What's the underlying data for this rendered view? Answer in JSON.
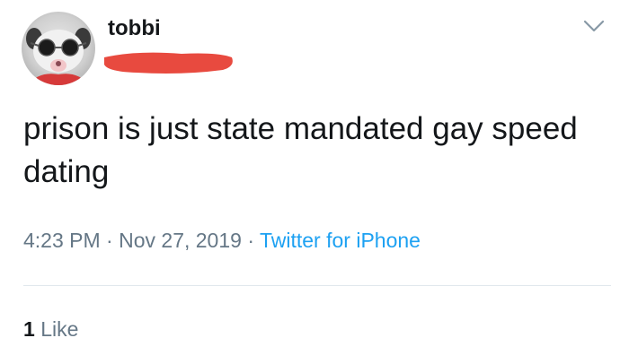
{
  "user": {
    "name": "tobbi",
    "avatar_icon": "opossum-with-sunglasses-avatar",
    "handle_redaction_color": "#e84a3f"
  },
  "menu_icon": "chevron-down-icon",
  "tweet": {
    "text": "prison is just state mandated gay speed dating",
    "time": "4:23 PM",
    "separator": "·",
    "date": "Nov 27, 2019",
    "source": "Twitter for iPhone"
  },
  "engagement": {
    "like_count": "1",
    "like_label": "Like"
  },
  "colors": {
    "meta_gray": "#657786",
    "link_blue": "#1da1f2",
    "text": "#14171a"
  }
}
